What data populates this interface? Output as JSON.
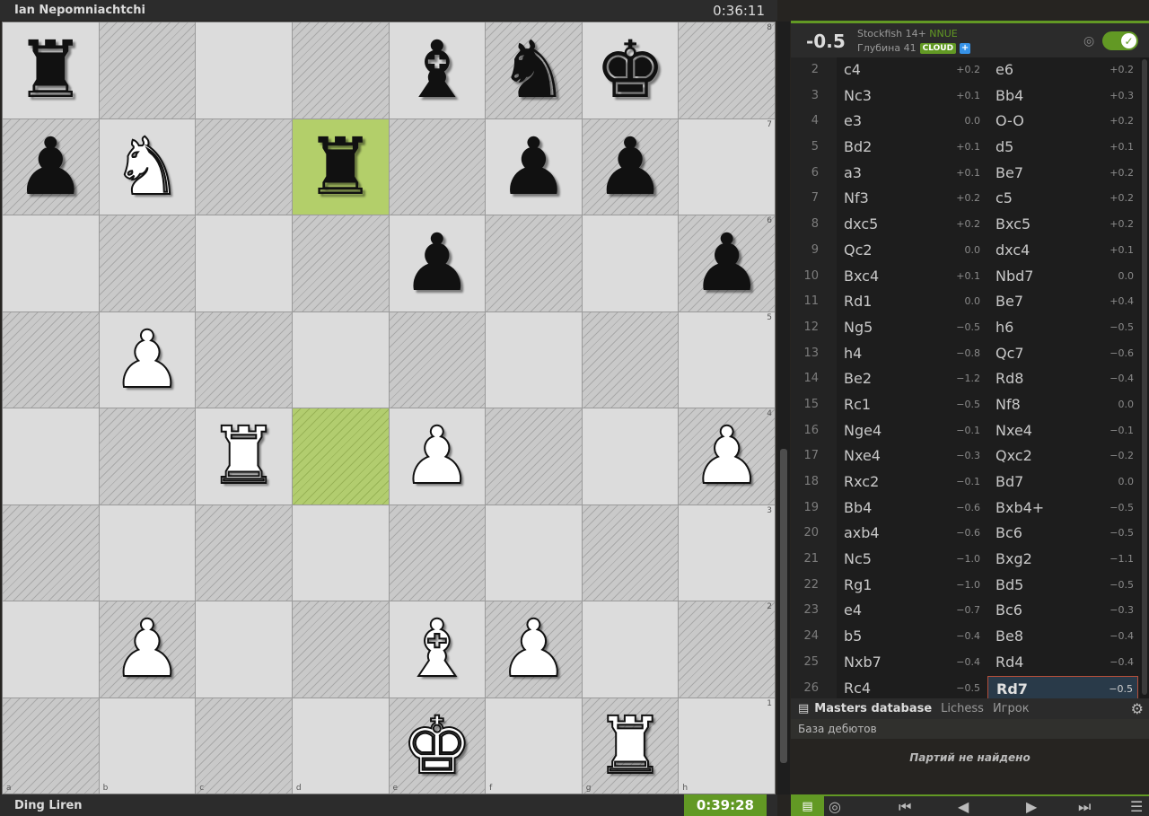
{
  "top_player": {
    "name": "Ian Nepomniachtchi",
    "clock": "0:36:11"
  },
  "bottom_player": {
    "name": "Ding Liren",
    "clock": "0:39:28"
  },
  "board": {
    "files": [
      "a",
      "b",
      "c",
      "d",
      "e",
      "f",
      "g",
      "h"
    ],
    "ranks": [
      "8",
      "7",
      "6",
      "5",
      "4",
      "3",
      "2",
      "1"
    ],
    "highlights": [
      "d7",
      "d4"
    ],
    "pieces": {
      "a8": "bR",
      "e8": "bB",
      "f8": "bN",
      "g8": "bK",
      "a7": "bP",
      "b7": "wN",
      "d7": "bR",
      "f7": "bP",
      "g7": "bP",
      "e6": "bP",
      "h6": "bP",
      "b5": "wP",
      "c4": "wR",
      "e4": "wP",
      "h4": "wP",
      "b2": "wP",
      "e2": "wB",
      "f2": "wP",
      "e1": "wK",
      "g1": "wR"
    }
  },
  "engine": {
    "eval": "-0.5",
    "name": "Stockfish 14+",
    "nnue": "NNUE",
    "depth": "Глубина 41",
    "cloud": "CLOUD",
    "plus": "+",
    "enabled": true
  },
  "moves": [
    {
      "n": "2",
      "w": "c4",
      "we": "+0.2",
      "b": "e6",
      "be": "+0.2"
    },
    {
      "n": "3",
      "w": "Nc3",
      "we": "+0.1",
      "b": "Bb4",
      "be": "+0.3"
    },
    {
      "n": "4",
      "w": "e3",
      "we": "0.0",
      "b": "O-O",
      "be": "+0.2"
    },
    {
      "n": "5",
      "w": "Bd2",
      "we": "+0.1",
      "b": "d5",
      "be": "+0.1"
    },
    {
      "n": "6",
      "w": "a3",
      "we": "+0.1",
      "b": "Be7",
      "be": "+0.2"
    },
    {
      "n": "7",
      "w": "Nf3",
      "we": "+0.2",
      "b": "c5",
      "be": "+0.2"
    },
    {
      "n": "8",
      "w": "dxc5",
      "we": "+0.2",
      "b": "Bxc5",
      "be": "+0.2"
    },
    {
      "n": "9",
      "w": "Qc2",
      "we": "0.0",
      "b": "dxc4",
      "be": "+0.1"
    },
    {
      "n": "10",
      "w": "Bxc4",
      "we": "+0.1",
      "b": "Nbd7",
      "be": "0.0"
    },
    {
      "n": "11",
      "w": "Rd1",
      "we": "0.0",
      "b": "Be7",
      "be": "+0.4"
    },
    {
      "n": "12",
      "w": "Ng5",
      "we": "−0.5",
      "b": "h6",
      "be": "−0.5"
    },
    {
      "n": "13",
      "w": "h4",
      "we": "−0.8",
      "b": "Qc7",
      "be": "−0.6"
    },
    {
      "n": "14",
      "w": "Be2",
      "we": "−1.2",
      "b": "Rd8",
      "be": "−0.4"
    },
    {
      "n": "15",
      "w": "Rc1",
      "we": "−0.5",
      "b": "Nf8",
      "be": "0.0"
    },
    {
      "n": "16",
      "w": "Nge4",
      "we": "−0.1",
      "b": "Nxe4",
      "be": "−0.1"
    },
    {
      "n": "17",
      "w": "Nxe4",
      "we": "−0.3",
      "b": "Qxc2",
      "be": "−0.2"
    },
    {
      "n": "18",
      "w": "Rxc2",
      "we": "−0.1",
      "b": "Bd7",
      "be": "0.0"
    },
    {
      "n": "19",
      "w": "Bb4",
      "we": "−0.6",
      "b": "Bxb4+",
      "be": "−0.5"
    },
    {
      "n": "20",
      "w": "axb4",
      "we": "−0.6",
      "b": "Bc6",
      "be": "−0.5"
    },
    {
      "n": "21",
      "w": "Nc5",
      "we": "−1.0",
      "b": "Bxg2",
      "be": "−1.1"
    },
    {
      "n": "22",
      "w": "Rg1",
      "we": "−1.0",
      "b": "Bd5",
      "be": "−0.5"
    },
    {
      "n": "23",
      "w": "e4",
      "we": "−0.7",
      "b": "Bc6",
      "be": "−0.3"
    },
    {
      "n": "24",
      "w": "b5",
      "we": "−0.4",
      "b": "Be8",
      "be": "−0.4"
    },
    {
      "n": "25",
      "w": "Nxb7",
      "we": "−0.4",
      "b": "Rd4",
      "be": "−0.4"
    },
    {
      "n": "26",
      "w": "Rc4",
      "we": "−0.5",
      "b": "Rd7",
      "be": "−0.5",
      "current": "b"
    }
  ],
  "explorer": {
    "tab_masters": "Masters database",
    "tab_lichess": "Lichess",
    "tab_player": "Игрок",
    "subtitle": "База дебютов",
    "empty": "Партий не найдено"
  },
  "icons": {
    "book": "book-icon",
    "target": "target-icon",
    "gear": "gear-icon",
    "first": "first-move-icon",
    "prev": "prev-move-icon",
    "next": "next-move-icon",
    "last": "last-move-icon",
    "menu": "hamburger-menu-icon"
  },
  "colors": {
    "accent": "#629924",
    "current_move_bg": "#293a49",
    "highlight": "#b3cf6a"
  }
}
